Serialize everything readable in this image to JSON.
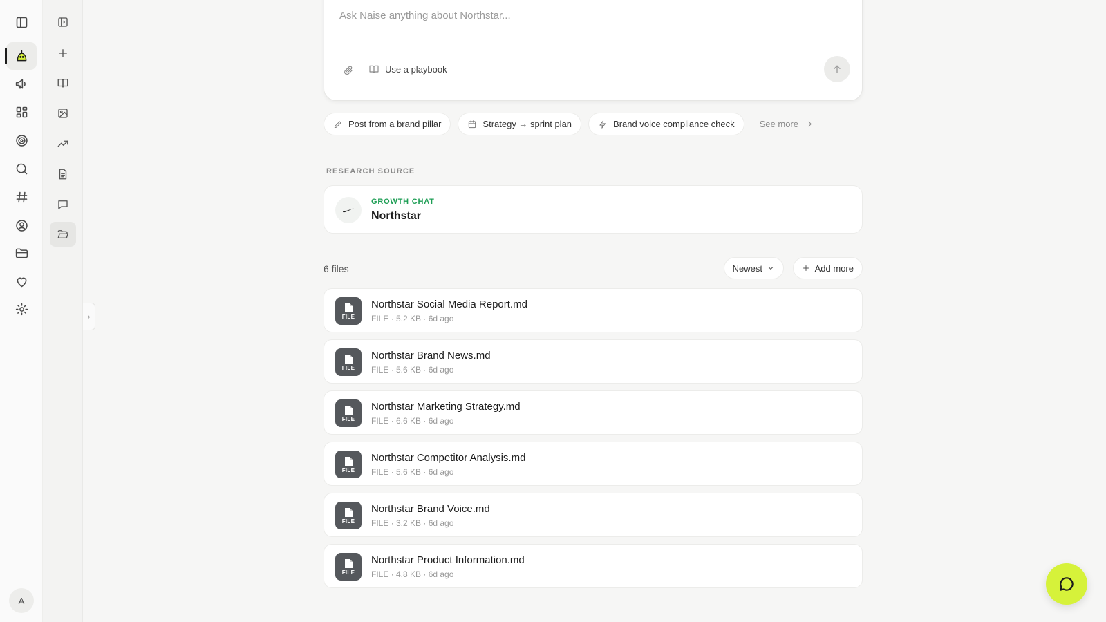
{
  "rail": {
    "items": [
      {
        "icon": "sidebar-toggle-icon",
        "label": "Toggle sidebar"
      },
      {
        "icon": "mascot-icon",
        "label": "Naise",
        "active": true
      },
      {
        "icon": "megaphone-icon",
        "label": "Campaigns"
      },
      {
        "icon": "grid-icon",
        "label": "Dashboard"
      },
      {
        "icon": "target-icon",
        "label": "Goals"
      },
      {
        "icon": "search-icon",
        "label": "Search"
      },
      {
        "icon": "hashtag-icon",
        "label": "Channels"
      },
      {
        "icon": "user-circle-icon",
        "label": "Profile"
      },
      {
        "icon": "folder-icon",
        "label": "Files"
      },
      {
        "icon": "heart-icon",
        "label": "Favorites"
      },
      {
        "icon": "gear-icon",
        "label": "Settings"
      }
    ],
    "avatar_initial": "A"
  },
  "panel": {
    "items": [
      {
        "icon": "panel-toggle-icon"
      },
      {
        "icon": "plus-icon"
      },
      {
        "icon": "book-icon"
      },
      {
        "icon": "image-icon"
      },
      {
        "icon": "trend-icon"
      },
      {
        "icon": "document-icon"
      },
      {
        "icon": "chat-icon"
      },
      {
        "icon": "folder-open-icon",
        "active": true
      }
    ]
  },
  "composer": {
    "placeholder": "Ask Naise anything about Northstar...",
    "playbook_label": "Use a playbook"
  },
  "suggestions": [
    {
      "icon": "pencil-icon",
      "label": "Post from a brand pillar"
    },
    {
      "icon": "calendar-icon",
      "label": "Strategy → sprint plan"
    },
    {
      "icon": "bolt-icon",
      "label": "Brand voice compliance check"
    }
  ],
  "see_more_label": "See more",
  "research": {
    "section_label": "RESEARCH SOURCE",
    "kicker": "GROWTH CHAT",
    "title": "Northstar"
  },
  "files": {
    "count_label": "6 files",
    "sort_label": "Newest",
    "add_label": "Add more",
    "icon_label": "FILE",
    "items": [
      {
        "name": "Northstar Social Media Report.md",
        "meta": "FILE · 5.2 KB · 6d ago"
      },
      {
        "name": "Northstar Brand News.md",
        "meta": "FILE · 5.6 KB · 6d ago"
      },
      {
        "name": "Northstar Marketing Strategy.md",
        "meta": "FILE · 6.6 KB · 6d ago"
      },
      {
        "name": "Northstar Competitor Analysis.md",
        "meta": "FILE · 5.6 KB · 6d ago"
      },
      {
        "name": "Northstar Brand Voice.md",
        "meta": "FILE · 3.2 KB · 6d ago"
      },
      {
        "name": "Northstar Product Information.md",
        "meta": "FILE · 4.8 KB · 6d ago"
      }
    ]
  },
  "colors": {
    "accent": "#d6f23a",
    "kicker_green": "#1e9e55",
    "file_icon_bg": "#55585c"
  }
}
